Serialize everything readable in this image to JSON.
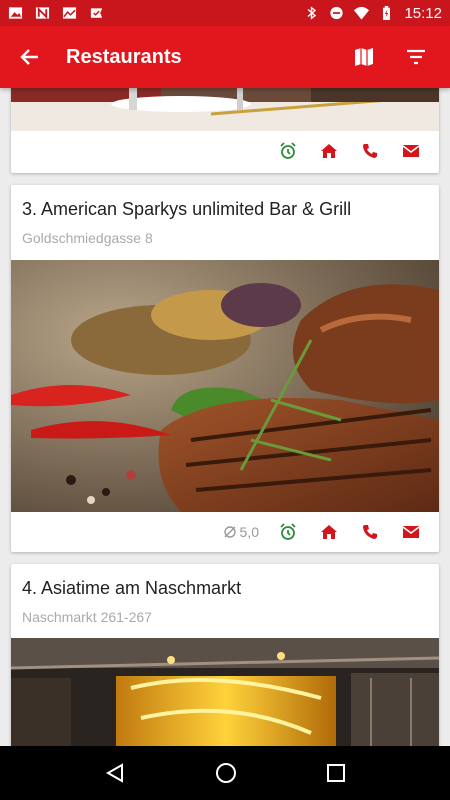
{
  "status_bar": {
    "time": "15:12",
    "left_icons": [
      "image-icon",
      "news-icon",
      "chart-icon",
      "check-icon"
    ],
    "right_icons": [
      "bluetooth-icon",
      "do-not-disturb-icon",
      "wifi-icon",
      "battery-icon"
    ]
  },
  "app_bar": {
    "title": "Restaurants",
    "back_icon": "arrow-back-icon",
    "map_icon": "map-icon",
    "filter_icon": "filter-icon"
  },
  "colors": {
    "primary": "#e2161d",
    "status": "#c9161c",
    "green": "#2e8b3a",
    "red": "#d4151b"
  },
  "restaurants": [
    {
      "name": "",
      "address": "",
      "rating": ""
    },
    {
      "name": "3. American Sparkys unlimited Bar & Grill",
      "address": "Goldschmiedgasse 8",
      "rating": "5,0"
    },
    {
      "name": "4. Asiatime am Naschmarkt",
      "address": "Naschmarkt 261-267",
      "rating": ""
    }
  ],
  "action_icons": [
    "alarm-icon",
    "home-icon",
    "phone-icon",
    "mail-icon"
  ],
  "nav_bar": [
    "back-icon",
    "home-icon",
    "recents-icon"
  ]
}
